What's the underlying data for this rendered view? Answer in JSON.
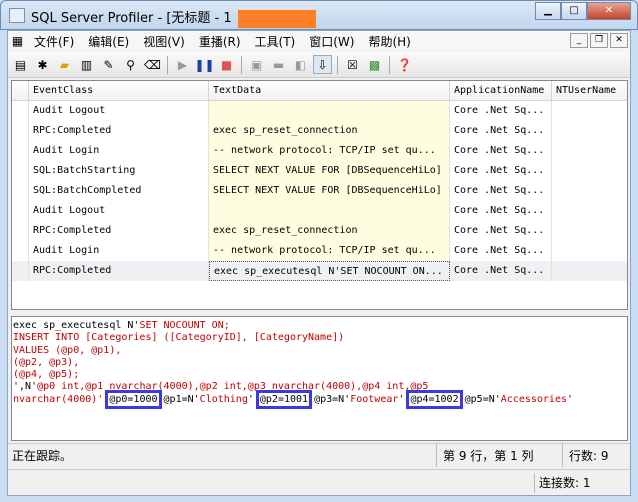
{
  "window": {
    "title": "SQL Server Profiler - [无标题 - 1"
  },
  "menu": [
    "文件(F)",
    "编辑(E)",
    "视图(V)",
    "重播(R)",
    "工具(T)",
    "窗口(W)",
    "帮助(H)"
  ],
  "grid": {
    "columns": [
      "EventClass",
      "TextData",
      "ApplicationName",
      "NTUserName"
    ],
    "rows": [
      {
        "event": "Audit Logout",
        "text": "",
        "app": "Core .Net Sq...",
        "user": ""
      },
      {
        "event": "RPC:Completed",
        "text": "exec sp_reset_connection",
        "app": "Core .Net Sq...",
        "user": ""
      },
      {
        "event": "Audit Login",
        "text": "-- network protocol: TCP/IP  set qu...",
        "app": "Core .Net Sq...",
        "user": ""
      },
      {
        "event": "SQL:BatchStarting",
        "text": "SELECT NEXT VALUE FOR [DBSequenceHiLo]",
        "app": "Core .Net Sq...",
        "user": ""
      },
      {
        "event": "SQL:BatchCompleted",
        "text": "SELECT NEXT VALUE FOR [DBSequenceHiLo]",
        "app": "Core .Net Sq...",
        "user": ""
      },
      {
        "event": "Audit Logout",
        "text": "",
        "app": "Core .Net Sq...",
        "user": ""
      },
      {
        "event": "RPC:Completed",
        "text": "exec sp_reset_connection",
        "app": "Core .Net Sq...",
        "user": ""
      },
      {
        "event": "Audit Login",
        "text": "-- network protocol: TCP/IP  set qu...",
        "app": "Core .Net Sq...",
        "user": ""
      },
      {
        "event": "RPC:Completed",
        "text": "exec sp_executesql N'SET NOCOUNT ON...",
        "app": "Core .Net Sq...",
        "user": ""
      }
    ]
  },
  "textpane": {
    "l1a": "exec sp_executesql N'",
    "l1b": "SET NOCOUNT ON;",
    "l2": "INSERT INTO [Categories] ([CategoryID], [CategoryName])",
    "l3": "VALUES (@p0, @p1),",
    "l4": "(@p2, @p3),",
    "l5": "(@p4, @p5);",
    "l6a": "',N'",
    "l6b": "@p0 int,@p1 nvarchar(4000),@p2 int,@p3 nvarchar(4000),@p4 int,@p5",
    "l7a": "nvarchar(4000)'",
    "l7b": ",",
    "p0": "@p0=1000",
    "l7c": ",@p1=N'",
    "l7d": "Clothing",
    "l7e": "',",
    "p2": "@p2=1001",
    "l7f": ",@p3=N'",
    "l7g": "Footwear",
    "l7h": "',",
    "p4": "@p4=1002",
    "l7i": ",@p5=N'",
    "l7j": "Accessories",
    "l7k": "'"
  },
  "status": {
    "msg": "正在跟踪。",
    "pos": "第 9 行，第 1 列",
    "rows": "行数: 9",
    "conn": "连接数: 1"
  }
}
